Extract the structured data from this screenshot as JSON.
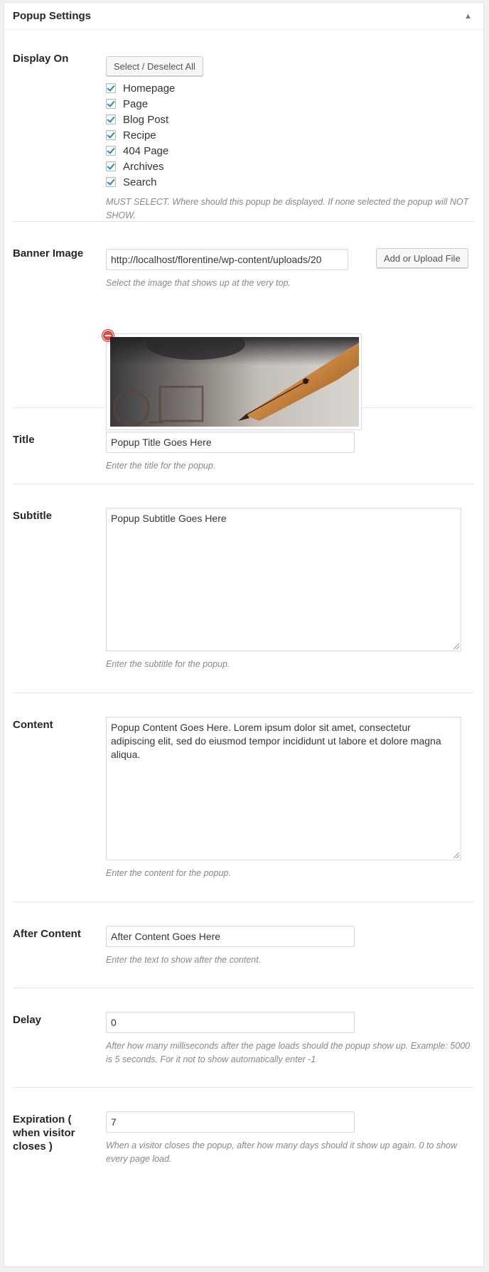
{
  "metabox": {
    "title": "Popup Settings"
  },
  "display_on": {
    "label": "Display On",
    "select_all_label": "Select / Deselect All",
    "options": [
      "Homepage",
      "Page",
      "Blog Post",
      "Recipe",
      "404 Page",
      "Archives",
      "Search"
    ],
    "description": "MUST SELECT. Where should this popup be displayed. If none selected the popup will NOT SHOW."
  },
  "banner_image": {
    "label": "Banner Image",
    "value": "http://localhost/florentine/wp-content/uploads/20",
    "upload_label": "Add or Upload File",
    "description": "Select the image that shows up at the very top."
  },
  "title": {
    "label": "Title",
    "value": "Popup Title Goes Here",
    "description": "Enter the title for the popup."
  },
  "subtitle": {
    "label": "Subtitle",
    "value": "Popup Subtitle Goes Here",
    "description": "Enter the subtitle for the popup."
  },
  "content": {
    "label": "Content",
    "value": "Popup Content Goes Here.  Lorem ipsum dolor sit amet, consectetur adipiscing elit, sed do eiusmod tempor incididunt ut labore et dolore magna aliqua.",
    "description": "Enter the content for the popup."
  },
  "after_content": {
    "label": "After Content",
    "value": "After Content Goes Here",
    "description": "Enter the text to show after the content."
  },
  "delay": {
    "label": "Delay",
    "value": "0",
    "description": "After how many milliseconds after the page loads should the popup show up. Example: 5000 is 5 seconds. For it not to show automatically enter -1"
  },
  "expiration": {
    "label": "Expiration ( when visitor closes )",
    "value": "7",
    "description": "When a visitor closes the popup, after how many days should it show up again. 0 to show every page load."
  },
  "colors": {
    "checkbox_accent": "#1e8cbe",
    "remove_icon": "#e14d43"
  }
}
